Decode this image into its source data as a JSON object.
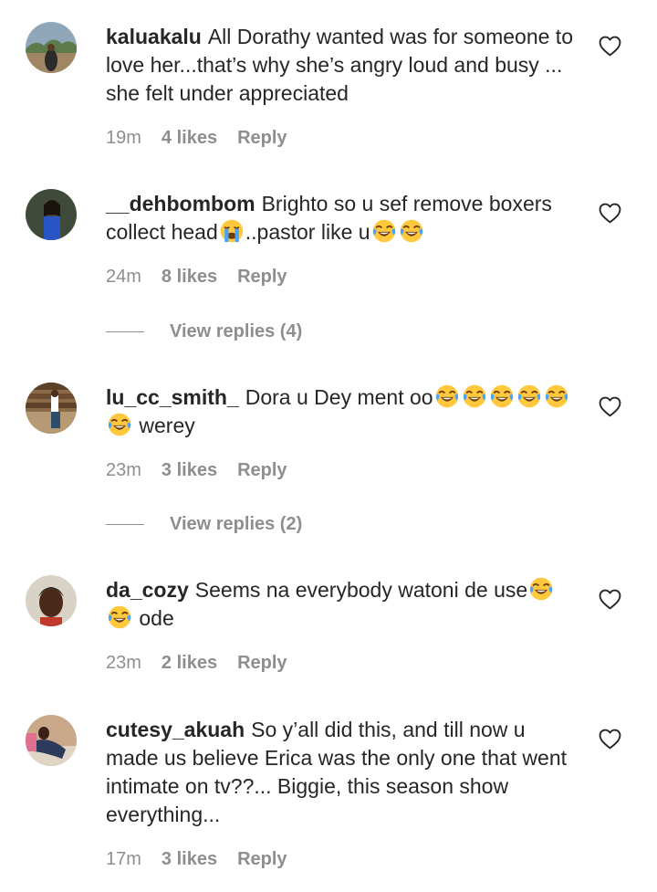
{
  "comments": [
    {
      "username": "kaluakalu",
      "text": "All Dorathy wanted was for someone to love her...that’s why she’s angry loud and busy ... she felt under appreciated",
      "time": "19m",
      "likes": "4 likes",
      "reply": "Reply"
    },
    {
      "username": "__dehbombom",
      "text_a": "Brighto so u sef remove boxers collect head",
      "text_b": "..pastor like u",
      "time": "24m",
      "likes": "8 likes",
      "reply": "Reply",
      "view_replies": "View replies (4)"
    },
    {
      "username": "lu_cc_smith_",
      "text_a": "Dora u Dey ment oo",
      "text_b": " werey",
      "time": "23m",
      "likes": "3 likes",
      "reply": "Reply",
      "view_replies": "View replies (2)"
    },
    {
      "username": "da_cozy",
      "text_a": "Seems na everybody watoni de use",
      "text_b": " ode",
      "time": "23m",
      "likes": "2 likes",
      "reply": "Reply"
    },
    {
      "username": "cutesy_akuah",
      "text": "So y’all did this, and till now u made us believe Erica was the only one that went intimate on tv??... Biggie, this season show everything...",
      "time": "17m",
      "likes": "3 likes",
      "reply": "Reply"
    }
  ],
  "icons": {
    "heart": "heart-outline-icon",
    "emoji_laugh": "face-with-tears-of-joy",
    "emoji_cry": "loudly-crying-face"
  },
  "colors": {
    "text": "#262626",
    "meta": "#8e8e8e",
    "background": "#ffffff"
  }
}
